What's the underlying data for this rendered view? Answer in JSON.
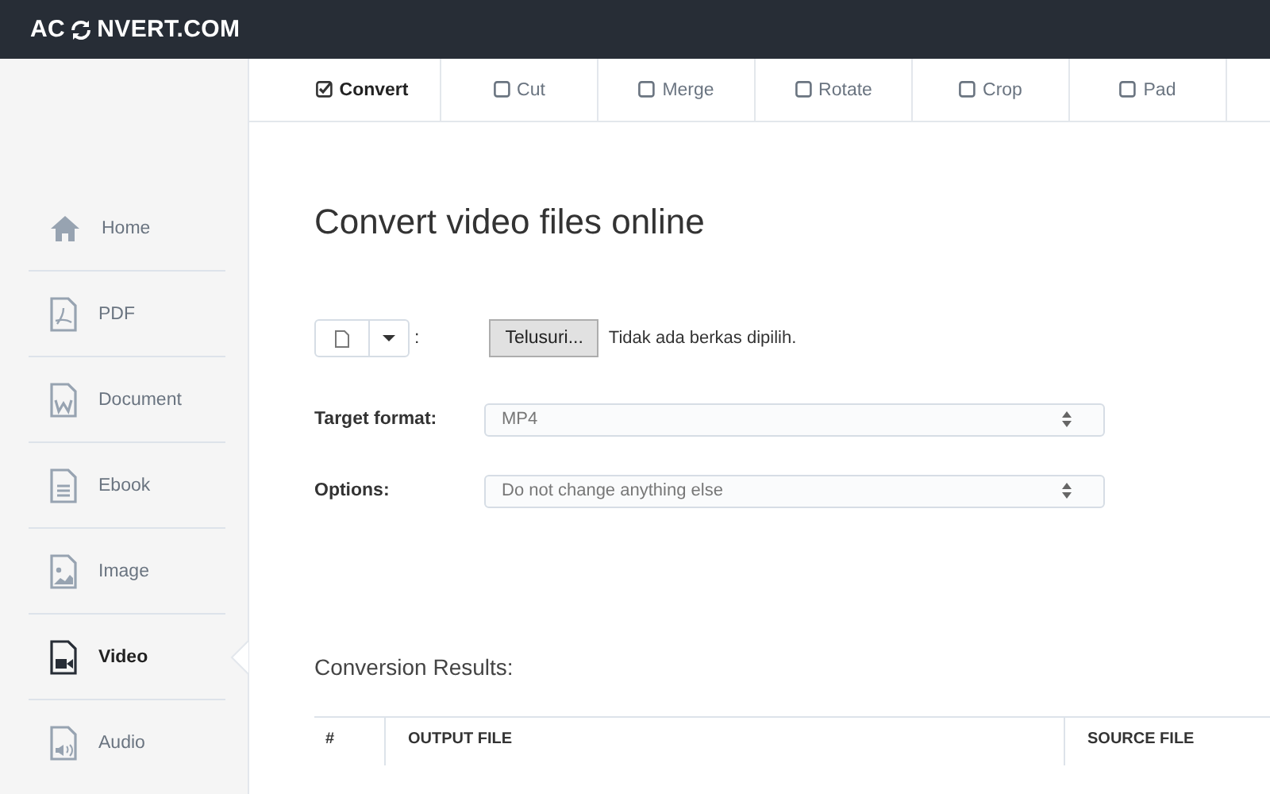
{
  "logo": {
    "start": "AC",
    "end": "NVERT.COM"
  },
  "sidebar": {
    "items": [
      {
        "label": "Home",
        "kind": "home",
        "selected": false
      },
      {
        "label": "PDF",
        "kind": "pdf",
        "selected": false
      },
      {
        "label": "Document",
        "kind": "document",
        "selected": false
      },
      {
        "label": "Ebook",
        "kind": "ebook",
        "selected": false
      },
      {
        "label": "Image",
        "kind": "image",
        "selected": false
      },
      {
        "label": "Video",
        "kind": "video",
        "selected": true
      },
      {
        "label": "Audio",
        "kind": "audio",
        "selected": false
      }
    ]
  },
  "tabs": [
    {
      "label": "Convert",
      "selected": true
    },
    {
      "label": "Cut",
      "selected": false
    },
    {
      "label": "Merge",
      "selected": false
    },
    {
      "label": "Rotate",
      "selected": false
    },
    {
      "label": "Crop",
      "selected": false
    },
    {
      "label": "Pad",
      "selected": false
    }
  ],
  "title": "Convert video files online",
  "file_input": {
    "colon": ":",
    "browse_button": "Telusuri...",
    "status": "Tidak ada berkas dipilih."
  },
  "fields": [
    {
      "label": "Target format:",
      "value": "MP4"
    },
    {
      "label": "Options:",
      "value": "Do not change anything else"
    }
  ],
  "results": {
    "heading": "Conversion Results:",
    "columns": [
      "#",
      "OUTPUT FILE",
      "SOURCE FILE"
    ]
  }
}
